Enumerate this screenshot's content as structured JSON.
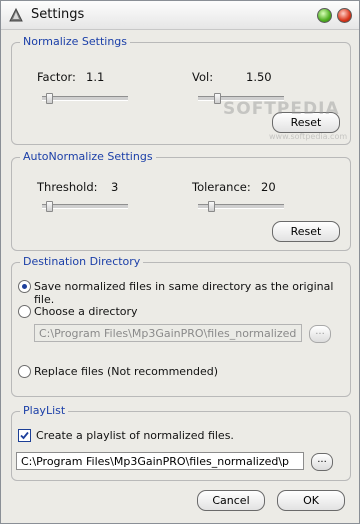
{
  "window": {
    "title": "Settings"
  },
  "normalize": {
    "title": "Normalize Settings",
    "factor_label": "Factor:",
    "factor_value": "1.1",
    "factor_level": 0.05,
    "vol_label": "Vol:",
    "vol_value": "1.50",
    "vol_level": 0.2,
    "reset_label": "Reset"
  },
  "autonormalize": {
    "title": "AutoNormalize Settings",
    "threshold_label": "Threshold:",
    "threshold_value": "3",
    "threshold_level": 0.05,
    "tolerance_label": "Tolerance:",
    "tolerance_value": "20",
    "tolerance_level": 0.12,
    "reset_label": "Reset"
  },
  "destination": {
    "title": "Destination Directory",
    "option_same_label": "Save normalized files in same directory as the original file.",
    "option_choose_label": "Choose a directory",
    "option_replace_label": "Replace files (Not recommended)",
    "selected": "same",
    "directory_value": "C:\\Program Files\\Mp3GainPRO\\files_normalized",
    "browse_label": "..."
  },
  "playlist": {
    "title": "PlayList",
    "create_label": "Create a playlist of normalized files.",
    "create_checked": true,
    "path_value": "C:\\Program Files\\Mp3GainPRO\\files_normalized\\p",
    "browse_label": "..."
  },
  "footer": {
    "cancel_label": "Cancel",
    "ok_label": "OK"
  },
  "watermark": {
    "brand": "SOFTPEDIA",
    "url": "www.softpedia.com"
  },
  "colors": {
    "group_title": "#1b3fa8",
    "window_bg": "#ecebe6"
  }
}
